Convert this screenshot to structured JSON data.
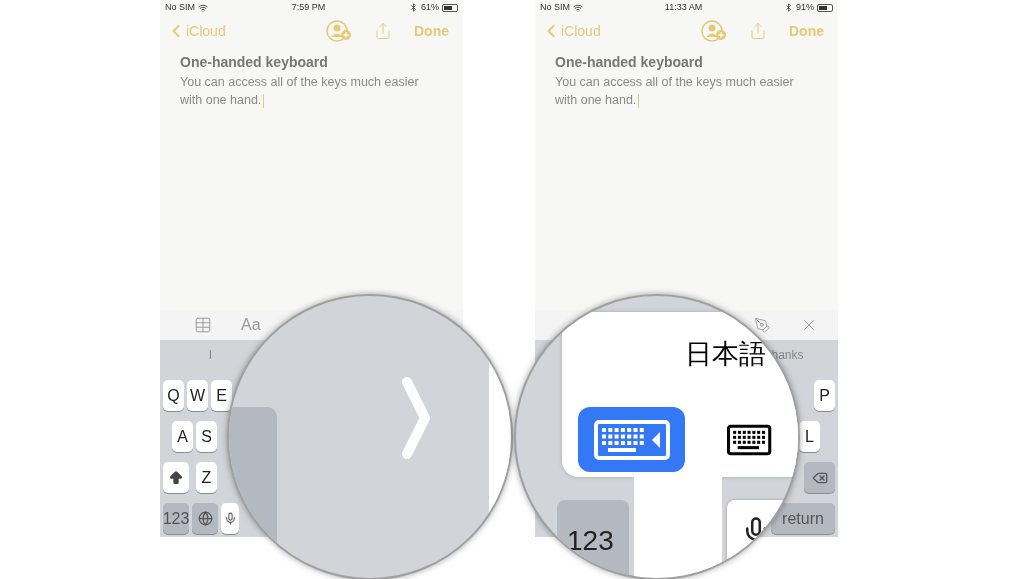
{
  "phones": [
    {
      "status": {
        "carrier": "No SIM",
        "time": "7:59 PM",
        "battery": "61%"
      },
      "nav": {
        "back": "iCloud",
        "done": "Done"
      },
      "note": {
        "title": "One-handed keyboard",
        "body": "You can access all of the keys much easier with one hand."
      },
      "toolbar": [
        {
          "kind": "table"
        },
        {
          "kind": "format",
          "label": "Aa"
        }
      ],
      "suggestions": [
        "I"
      ],
      "key_rows": [
        [
          {
            "kind": "letter",
            "label": "Q"
          },
          {
            "kind": "letter",
            "label": "W"
          },
          {
            "kind": "letter",
            "label": "E"
          }
        ],
        [
          {
            "kind": "letter",
            "label": "A"
          },
          {
            "kind": "letter",
            "label": "S"
          }
        ],
        [
          {
            "kind": "shift"
          },
          {
            "kind": "letter",
            "label": "Z"
          }
        ],
        [
          {
            "kind": "mode",
            "label": "123"
          },
          {
            "kind": "globe"
          },
          {
            "kind": "mic"
          }
        ]
      ],
      "magnifier": {
        "kind": "chevron"
      }
    },
    {
      "status": {
        "carrier": "No SIM",
        "time": "11:33 AM",
        "battery": "91%"
      },
      "nav": {
        "back": "iCloud",
        "done": "Done"
      },
      "note": {
        "title": "One-handed keyboard",
        "body": "You can access all of the keys much easier with one hand."
      },
      "toolbar": [
        {
          "kind": "markup"
        },
        {
          "kind": "close"
        }
      ],
      "suggestions": [
        "hanks"
      ],
      "key_rows": [
        [
          {
            "kind": "letter",
            "label": "P"
          }
        ],
        [
          {
            "kind": "letter",
            "label": "L"
          }
        ],
        [
          {
            "kind": "delete"
          }
        ],
        [
          {
            "kind": "return",
            "label": "return"
          }
        ]
      ],
      "magnifier": {
        "kind": "switcher",
        "language": "日本語",
        "numbers": "123",
        "options": [
          {
            "kind": "one-handed-left",
            "selected": true
          },
          {
            "kind": "full",
            "selected": false
          }
        ]
      }
    }
  ]
}
